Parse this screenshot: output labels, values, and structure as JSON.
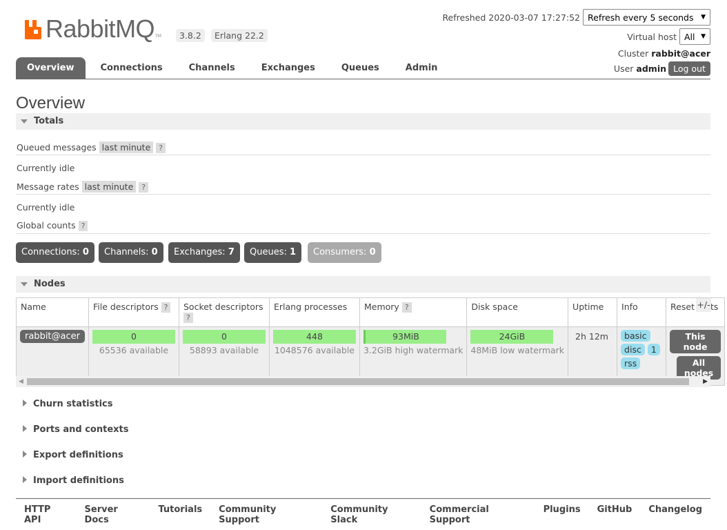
{
  "header": {
    "brand": "RabbitMQ",
    "trademark": "TM",
    "version": "3.8.2",
    "erlang": "Erlang 22.2",
    "refreshed_label": "Refreshed 2020-03-07 17:27:52",
    "refresh_option": "Refresh every 5 seconds",
    "vhost_label": "Virtual host",
    "vhost_value": "All",
    "cluster_label": "Cluster",
    "cluster_name": "rabbit@acer",
    "user_label": "User",
    "user_name": "admin",
    "logout": "Log out"
  },
  "tabs": [
    "Overview",
    "Connections",
    "Channels",
    "Exchanges",
    "Queues",
    "Admin"
  ],
  "page_title": "Overview",
  "totals": {
    "title": "Totals",
    "queued_label": "Queued messages",
    "queued_period": "last minute",
    "help": "?",
    "idle1": "Currently idle",
    "rates_label": "Message rates",
    "rates_period": "last minute",
    "idle2": "Currently idle",
    "global_label": "Global counts"
  },
  "counts": [
    {
      "label": "Connections:",
      "value": "0"
    },
    {
      "label": "Channels:",
      "value": "0"
    },
    {
      "label": "Exchanges:",
      "value": "7"
    },
    {
      "label": "Queues:",
      "value": "1"
    },
    {
      "label": "Consumers:",
      "value": "0"
    }
  ],
  "nodes": {
    "title": "Nodes",
    "columns": [
      "Name",
      "File descriptors",
      "Socket descriptors",
      "Erlang processes",
      "Memory",
      "Disk space",
      "Uptime",
      "Info",
      "Reset stats"
    ],
    "plusminus": "+/-",
    "row": {
      "name": "rabbit@acer",
      "fd": "0",
      "fd_sub": "65536 available",
      "sd": "0",
      "sd_sub": "58893 available",
      "ep": "448",
      "ep_sub": "1048576 available",
      "mem": "93MiB",
      "mem_sub": "3.2GiB high watermark",
      "disk": "24GiB",
      "disk_sub": "48MiB low watermark",
      "uptime": "2h 12m",
      "info": [
        "basic",
        "disc",
        "1",
        "rss"
      ],
      "reset_this": "This node",
      "reset_all": "All nodes"
    }
  },
  "sections": [
    "Churn statistics",
    "Ports and contexts",
    "Export definitions",
    "Import definitions"
  ],
  "footer": [
    "HTTP API",
    "Server Docs",
    "Tutorials",
    "Community Support",
    "Community Slack",
    "Commercial Support",
    "Plugins",
    "GitHub",
    "Changelog"
  ],
  "colors": {
    "accent": "#ff6600",
    "tab_active": "#666666",
    "ok_bar": "#99ee88",
    "info_pill": "#99ddee"
  }
}
